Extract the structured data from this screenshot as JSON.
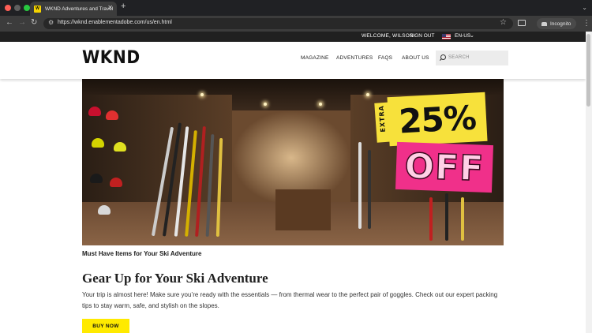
{
  "browser": {
    "tab_title": "WKND Adventures and Travel",
    "tab_favicon_text": "W",
    "new_tab": "+",
    "url": "https://wknd.enablementadobe.com/us/en.html",
    "incognito_label": "Incognito"
  },
  "utility": {
    "welcome": "WELCOME, WILSON",
    "sign_out": "SIGN OUT",
    "language": "EN-US"
  },
  "header": {
    "logo": "WKND",
    "nav": [
      "MAGAZINE",
      "ADVENTURES",
      "FAQS",
      "ABOUT US"
    ],
    "search_placeholder": "SEARCH"
  },
  "hero": {
    "promo_extra": "EXTRA",
    "promo_percent": "25%",
    "promo_off": "OFF"
  },
  "content": {
    "caption": "Must Have Items for Your Ski Adventure",
    "headline": "Gear Up for Your Ski Adventure",
    "body": "Your trip is almost here! Make sure you’re ready with the essentials — from thermal wear to the perfect pair of goggles. Check out our expert packing tips to stay warm, safe, and stylish on the slopes.",
    "cta": "BUY NOW"
  },
  "colors": {
    "accent_yellow": "#ffea00",
    "promo_pink": "#f0308a",
    "utility_bar": "#202020"
  }
}
